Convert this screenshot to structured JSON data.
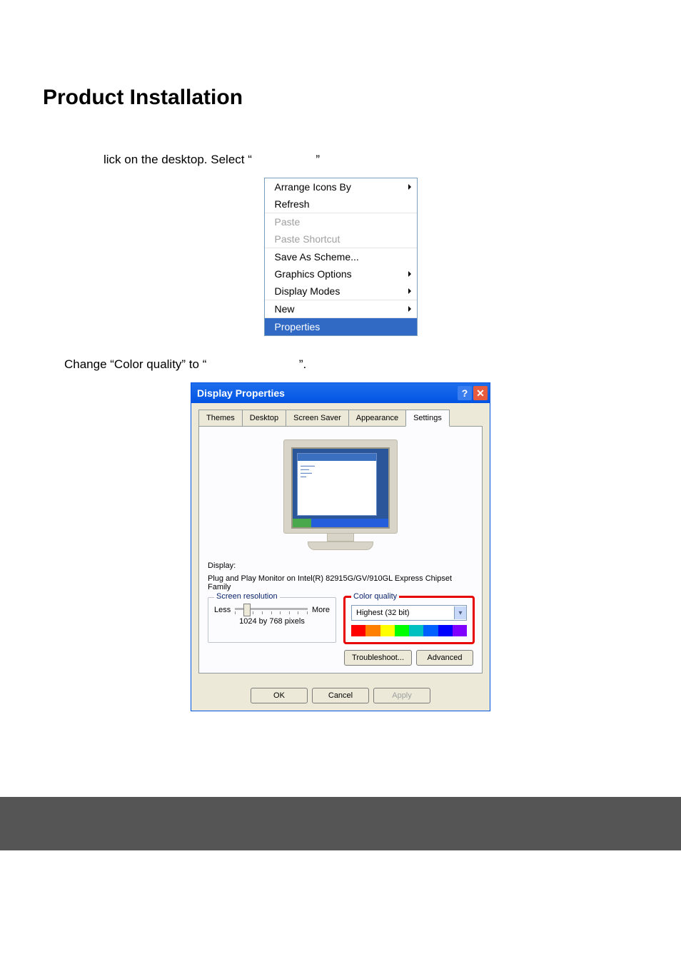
{
  "doc": {
    "heading": "Product Installation",
    "step1_before": "lick on the desktop. Select “",
    "step1_after": "”",
    "step2_before": "Change “Color quality” to “",
    "step2_after": "”."
  },
  "contextMenu": {
    "arrangeIcons": "Arrange Icons By",
    "refresh": "Refresh",
    "paste": "Paste",
    "pasteShortcut": "Paste Shortcut",
    "saveAsScheme": "Save As Scheme...",
    "graphicsOptions": "Graphics Options",
    "displayModes": "Display Modes",
    "newItem": "New",
    "properties": "Properties"
  },
  "dialog": {
    "title": "Display Properties",
    "tabs": {
      "themes": "Themes",
      "desktop": "Desktop",
      "screenSaver": "Screen Saver",
      "appearance": "Appearance",
      "settings": "Settings"
    },
    "displayLabel": "Display:",
    "displayValue": "Plug and Play Monitor on Intel(R) 82915G/GV/910GL Express Chipset Family",
    "screenResolution": {
      "title": "Screen resolution",
      "less": "Less",
      "more": "More",
      "value": "1024 by 768 pixels"
    },
    "colorQuality": {
      "title": "Color quality",
      "value": "Highest (32 bit)"
    },
    "buttons": {
      "troubleshoot": "Troubleshoot...",
      "advanced": "Advanced",
      "ok": "OK",
      "cancel": "Cancel",
      "apply": "Apply"
    }
  }
}
